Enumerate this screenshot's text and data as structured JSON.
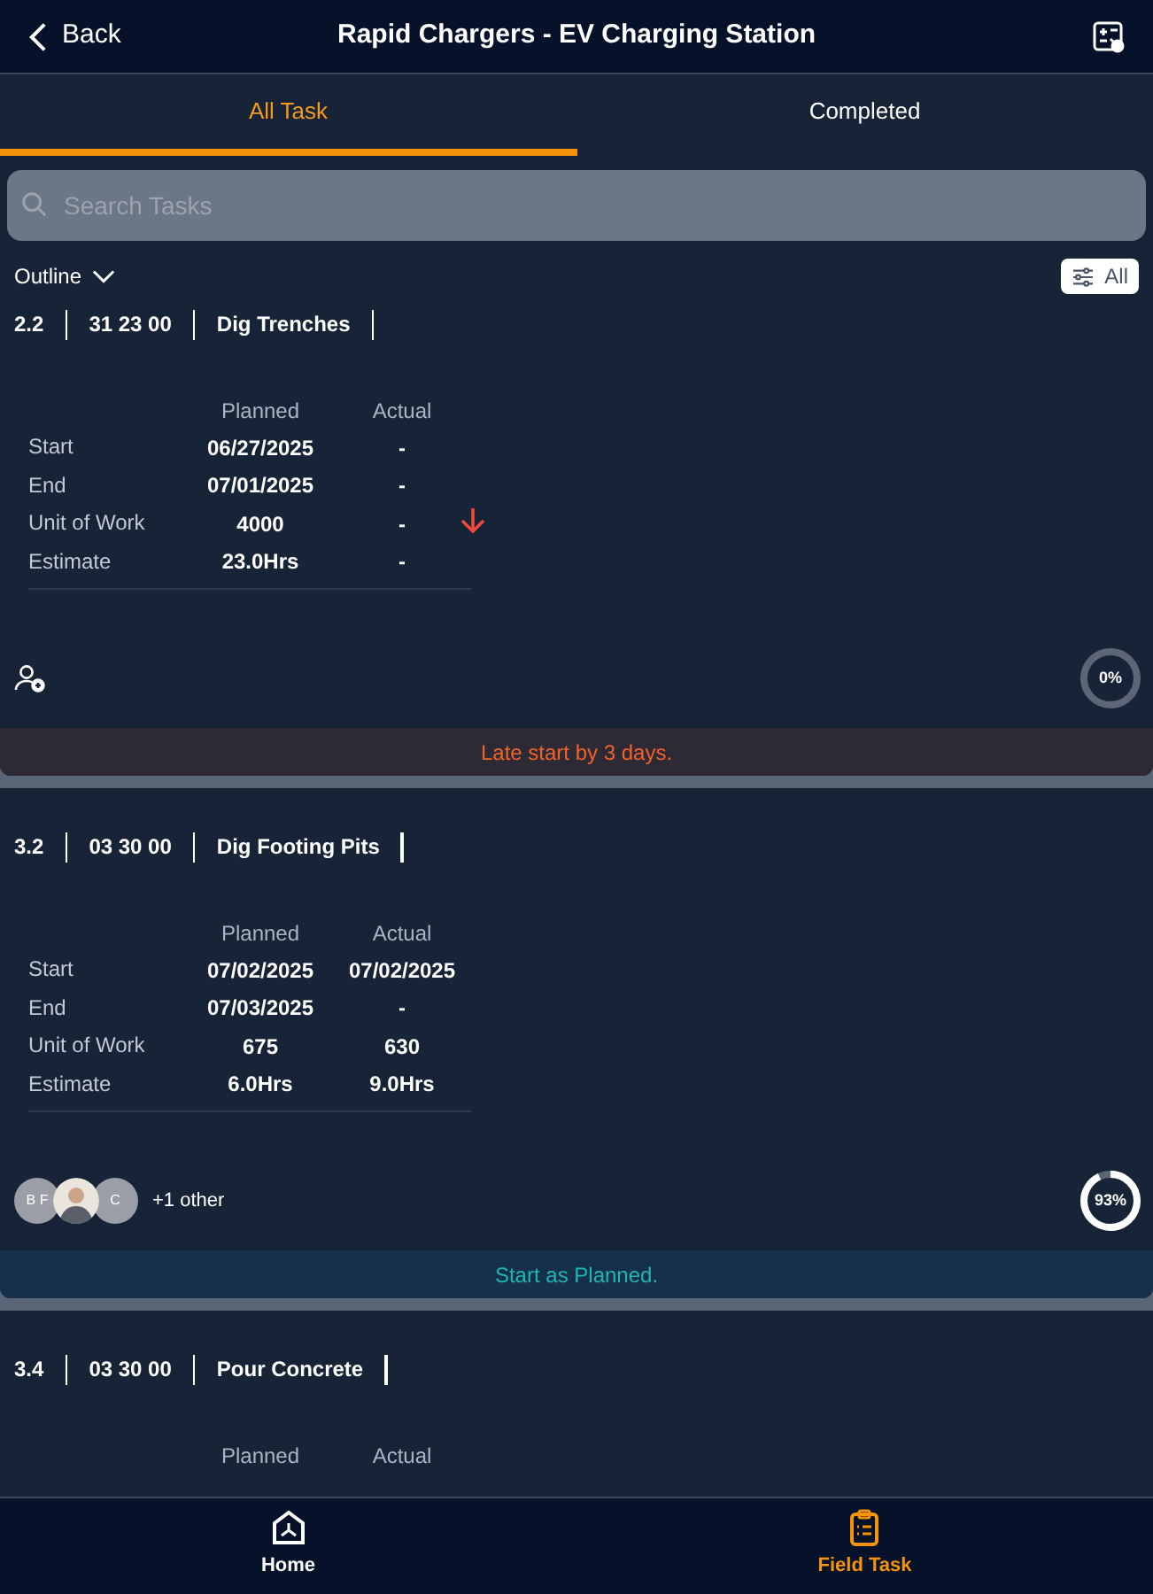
{
  "header": {
    "back": "Back",
    "title": "Rapid Chargers - EV Charging Station"
  },
  "tabs": [
    {
      "label": "All Task",
      "selected": true
    },
    {
      "label": "Completed",
      "selected": false
    }
  ],
  "search": {
    "placeholder": "Search Tasks"
  },
  "outline": {
    "label": "Outline",
    "filter": "All"
  },
  "tasks": [
    {
      "number": "2.2",
      "code": "31 23 00",
      "name": "Dig Trenches",
      "columns": [
        "Planned",
        "Actual"
      ],
      "rows": [
        {
          "label": "Start",
          "planned": "06/27/2025",
          "actual": "-"
        },
        {
          "label": "End",
          "planned": "07/01/2025",
          "actual": "-"
        },
        {
          "label": "Unit of Work",
          "planned": "4000",
          "actual": "-"
        },
        {
          "label": "Estimate",
          "planned": "23.0Hrs",
          "actual": "-"
        }
      ],
      "behind_schedule": true,
      "progress": {
        "level": 0,
        "reading": "0%"
      },
      "status": {
        "kind": "late",
        "text": "Late start by 3 days."
      }
    },
    {
      "number": "3.2",
      "code": "03 30 00",
      "name": "Dig Footing Pits",
      "columns": [
        "Planned",
        "Actual"
      ],
      "rows": [
        {
          "label": "Start",
          "planned": "07/02/2025",
          "actual": "07/02/2025"
        },
        {
          "label": "End",
          "planned": "07/03/2025",
          "actual": "-"
        },
        {
          "label": "Unit of Work",
          "planned": "675",
          "actual": "630"
        },
        {
          "label": "Estimate",
          "planned": "6.0Hrs",
          "actual": "9.0Hrs"
        }
      ],
      "behind_schedule": false,
      "assignees": [
        {
          "kind": "initials",
          "text": "B F"
        },
        {
          "kind": "photo"
        },
        {
          "kind": "initials",
          "text": "C"
        }
      ],
      "more": "+1 other",
      "progress": {
        "level": 0.93,
        "reading": "93%"
      },
      "status": {
        "kind": "on_plan",
        "text": "Start as Planned."
      }
    },
    {
      "number": "3.4",
      "code": "03 30 00",
      "name": "Pour Concrete",
      "columns": [
        "Planned",
        "Actual"
      ]
    }
  ],
  "nav": [
    {
      "label": "Home",
      "kind": "home",
      "selected": false
    },
    {
      "label": "Field Task",
      "kind": "task",
      "selected": true
    }
  ]
}
